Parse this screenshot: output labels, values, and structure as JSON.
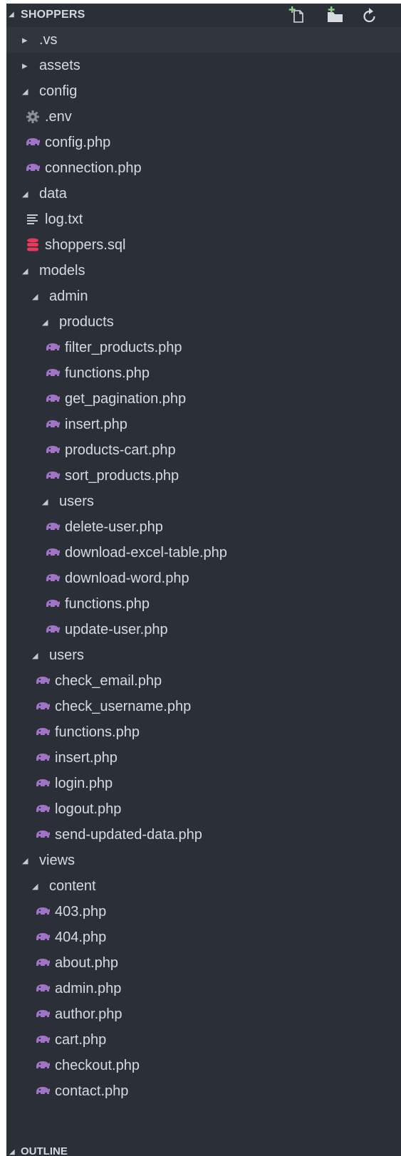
{
  "explorer": {
    "section_title": "SHOPPERS",
    "actions": [
      {
        "name": "new-file-icon"
      },
      {
        "name": "new-folder-icon"
      },
      {
        "name": "refresh-icon"
      }
    ]
  },
  "tree": [
    {
      "label": ".vs",
      "type": "folder",
      "expanded": false,
      "depth": 1
    },
    {
      "label": "assets",
      "type": "folder",
      "expanded": false,
      "depth": 1
    },
    {
      "label": "config",
      "type": "folder",
      "expanded": true,
      "depth": 1
    },
    {
      "label": ".env",
      "type": "env",
      "depth": 1
    },
    {
      "label": "config.php",
      "type": "php",
      "depth": 1
    },
    {
      "label": "connection.php",
      "type": "php",
      "depth": 1
    },
    {
      "label": "data",
      "type": "folder",
      "expanded": true,
      "depth": 1
    },
    {
      "label": "log.txt",
      "type": "txt",
      "depth": 1
    },
    {
      "label": "shoppers.sql",
      "type": "sql",
      "depth": 1
    },
    {
      "label": "models",
      "type": "folder",
      "expanded": true,
      "depth": 1
    },
    {
      "label": "admin",
      "type": "folder",
      "expanded": true,
      "depth": 2
    },
    {
      "label": "products",
      "type": "folder",
      "expanded": true,
      "depth": 3
    },
    {
      "label": "filter_products.php",
      "type": "php",
      "depth": 3
    },
    {
      "label": "functions.php",
      "type": "php",
      "depth": 3
    },
    {
      "label": "get_pagination.php",
      "type": "php",
      "depth": 3
    },
    {
      "label": "insert.php",
      "type": "php",
      "depth": 3
    },
    {
      "label": "products-cart.php",
      "type": "php",
      "depth": 3
    },
    {
      "label": "sort_products.php",
      "type": "php",
      "depth": 3
    },
    {
      "label": "users",
      "type": "folder",
      "expanded": true,
      "depth": 3
    },
    {
      "label": "delete-user.php",
      "type": "php",
      "depth": 3
    },
    {
      "label": "download-excel-table.php",
      "type": "php",
      "depth": 3
    },
    {
      "label": "download-word.php",
      "type": "php",
      "depth": 3
    },
    {
      "label": "functions.php",
      "type": "php",
      "depth": 3
    },
    {
      "label": "update-user.php",
      "type": "php",
      "depth": 3
    },
    {
      "label": "users",
      "type": "folder",
      "expanded": true,
      "depth": 2
    },
    {
      "label": "check_email.php",
      "type": "php",
      "depth": 2
    },
    {
      "label": "check_username.php",
      "type": "php",
      "depth": 2
    },
    {
      "label": "functions.php",
      "type": "php",
      "depth": 2
    },
    {
      "label": "insert.php",
      "type": "php",
      "depth": 2
    },
    {
      "label": "login.php",
      "type": "php",
      "depth": 2
    },
    {
      "label": "logout.php",
      "type": "php",
      "depth": 2
    },
    {
      "label": "send-updated-data.php",
      "type": "php",
      "depth": 2
    },
    {
      "label": "views",
      "type": "folder",
      "expanded": true,
      "depth": 1
    },
    {
      "label": "content",
      "type": "folder",
      "expanded": true,
      "depth": 2
    },
    {
      "label": "403.php",
      "type": "php",
      "depth": 2
    },
    {
      "label": "404.php",
      "type": "php",
      "depth": 2
    },
    {
      "label": "about.php",
      "type": "php",
      "depth": 2
    },
    {
      "label": "admin.php",
      "type": "php",
      "depth": 2
    },
    {
      "label": "author.php",
      "type": "php",
      "depth": 2
    },
    {
      "label": "cart.php",
      "type": "php",
      "depth": 2
    },
    {
      "label": "checkout.php",
      "type": "php",
      "depth": 2
    },
    {
      "label": "contact.php",
      "type": "php",
      "depth": 2
    }
  ],
  "outline": {
    "section_title": "OUTLINE"
  },
  "colors": {
    "background": "#2b2f37",
    "text": "#d7dae0",
    "php_icon": "#a074c4",
    "sql_icon": "#e8385e",
    "env_icon": "#8a8f98",
    "txt_icon": "#c5c9cf",
    "new_icon_accent": "#89d185"
  }
}
